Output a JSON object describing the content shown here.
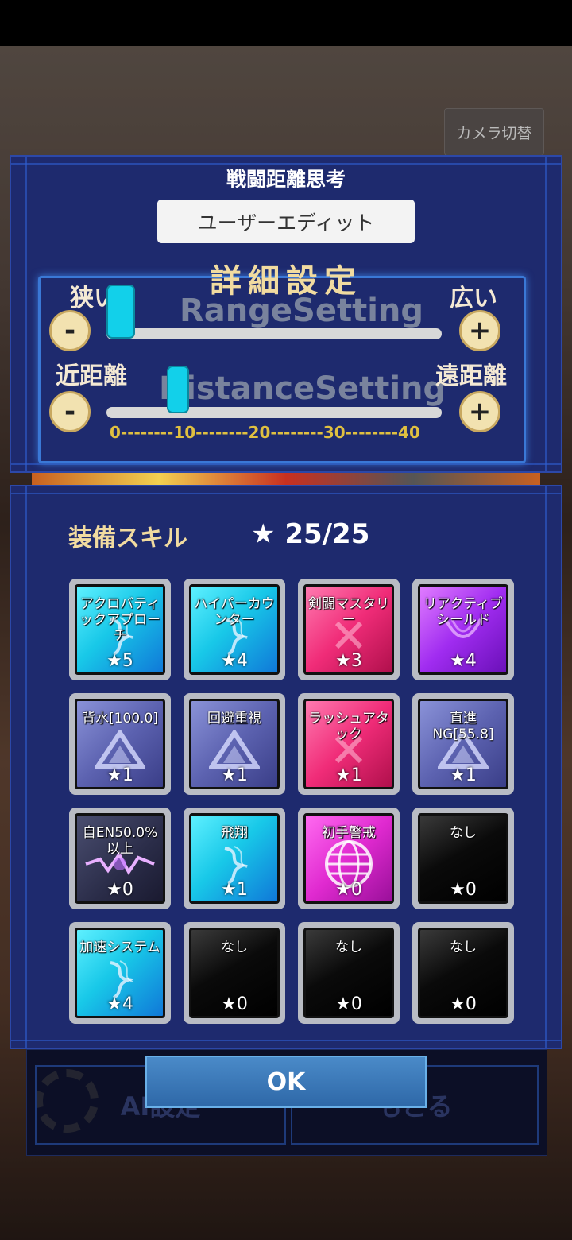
{
  "camera_button": "カメラ切替",
  "background": {
    "ai_label": "AI設定",
    "back_label": "もどる"
  },
  "top_panel": {
    "title": "戦闘距離思考",
    "mode": "ユーザーエディット",
    "detail_title": "詳細設定",
    "range": {
      "left_label": "狭い",
      "right_label": "広い",
      "ghost": "RangeSetting",
      "value_fraction": 0.0
    },
    "distance": {
      "left_label": "近距離",
      "right_label": "遠距離",
      "ghost": "DistanceSetting",
      "value": 10
    },
    "scale_text": "0--------10--------20--------30--------40",
    "minus": "-",
    "plus": "+"
  },
  "skills": {
    "label": "装備スキル",
    "count": "★ 25/25",
    "items": [
      {
        "name": "アクロバティックアプローチ",
        "stars": "★5",
        "color": "cyan",
        "icon": "wind-icon"
      },
      {
        "name": "ハイパーカウンター",
        "stars": "★4",
        "color": "cyan",
        "icon": "wind-icon"
      },
      {
        "name": "剣闘マスタリー",
        "stars": "★3",
        "color": "pink",
        "icon": "sword-icon"
      },
      {
        "name": "リアクティブシールド",
        "stars": "★4",
        "color": "purple",
        "icon": "shield-icon"
      },
      {
        "name": "背水[100.0]",
        "stars": "★1",
        "color": "slate",
        "icon": "triangle-icon"
      },
      {
        "name": "回避重視",
        "stars": "★1",
        "color": "slate",
        "icon": "triangle-icon"
      },
      {
        "name": "ラッシュアタック",
        "stars": "★1",
        "color": "pink",
        "icon": "sword-icon"
      },
      {
        "name": "直進NG[55.8]",
        "stars": "★1",
        "color": "slate",
        "icon": "triangle-icon"
      },
      {
        "name": "自EN50.0%以上",
        "stars": "★0",
        "color": "dark",
        "icon": "spark-icon"
      },
      {
        "name": "飛翔",
        "stars": "★1",
        "color": "cyan",
        "icon": "wind-icon"
      },
      {
        "name": "初手警戒",
        "stars": "★0",
        "color": "magenta",
        "icon": "globe-icon"
      },
      {
        "name": "なし",
        "stars": "★0",
        "color": "black",
        "icon": ""
      },
      {
        "name": "加速システム",
        "stars": "★4",
        "color": "cyan",
        "icon": "wind-icon"
      },
      {
        "name": "なし",
        "stars": "★0",
        "color": "black",
        "icon": ""
      },
      {
        "name": "なし",
        "stars": "★0",
        "color": "black",
        "icon": ""
      },
      {
        "name": "なし",
        "stars": "★0",
        "color": "black",
        "icon": ""
      }
    ]
  },
  "ok_button": "OK"
}
